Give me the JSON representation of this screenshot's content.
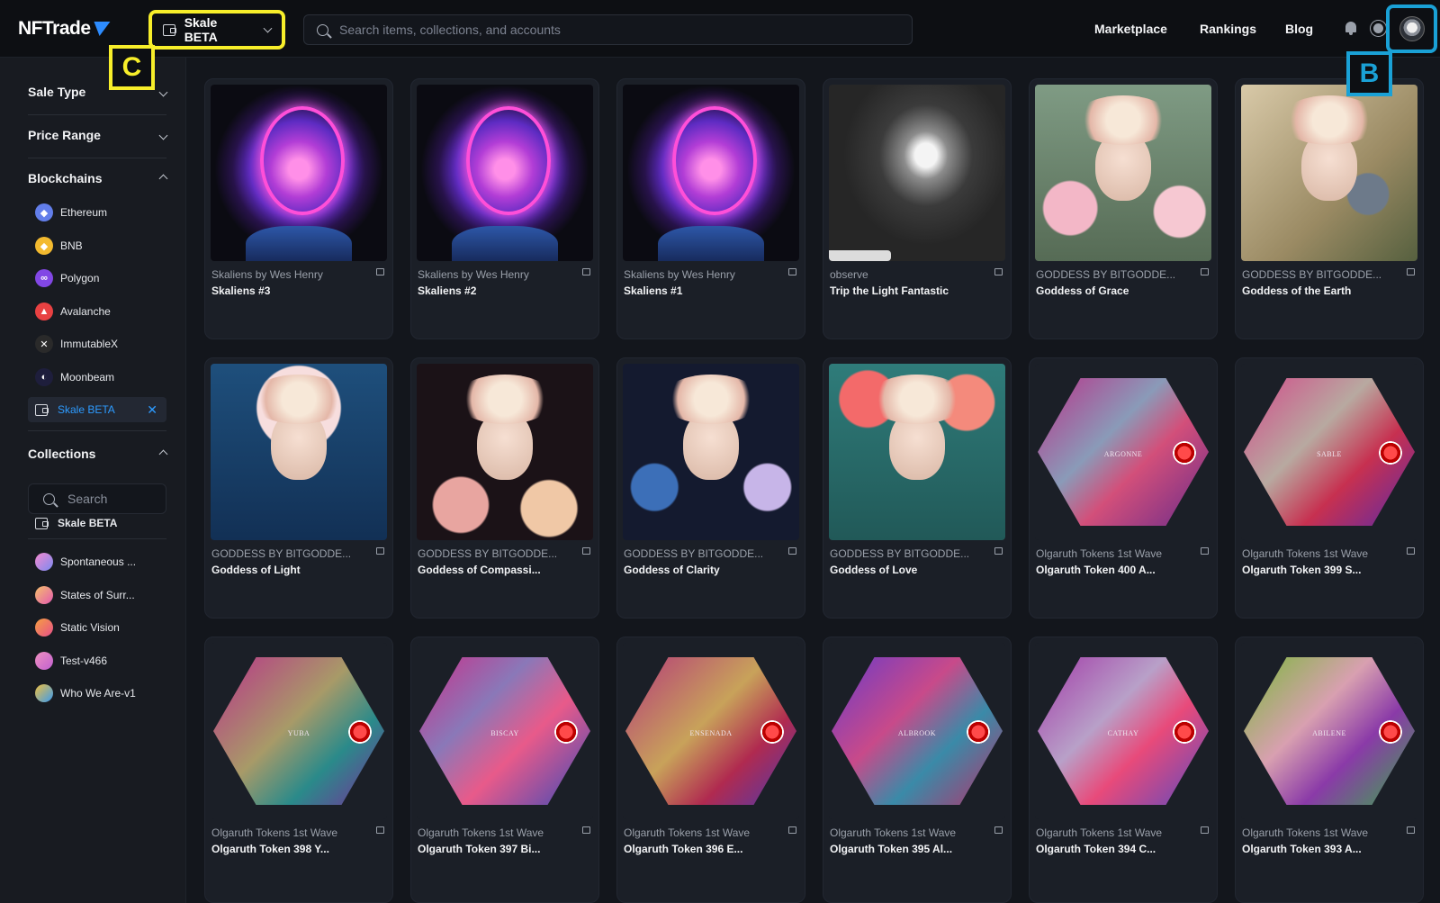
{
  "header": {
    "logo": "NFTrade",
    "chain_selector": "Skale BETA",
    "search_placeholder": "Search items, collections, and accounts",
    "nav": [
      "Marketplace",
      "Rankings",
      "Blog"
    ],
    "callout_c": "C",
    "callout_b": "B",
    "colors": {
      "callout_c": "#f7ee2a",
      "callout_b": "#1aa1d6"
    }
  },
  "sidebar": {
    "sale_type": "Sale Type",
    "price_range": "Price Range",
    "blockchains_title": "Blockchains",
    "blockchains": [
      {
        "label": "Ethereum",
        "icon": "ethereum-icon",
        "color": "#627eea"
      },
      {
        "label": "BNB",
        "icon": "bnb-icon",
        "color": "#f3ba2f"
      },
      {
        "label": "Polygon",
        "icon": "polygon-icon",
        "color": "#8247e5"
      },
      {
        "label": "Avalanche",
        "icon": "avalanche-icon",
        "color": "#e84142"
      },
      {
        "label": "ImmutableX",
        "icon": "immutablex-icon",
        "color": "#2a2a2a"
      },
      {
        "label": "Moonbeam",
        "icon": "moonbeam-icon",
        "color": "#1e1e3c"
      },
      {
        "label": "Skale BETA",
        "icon": "wallet-icon",
        "color": "#2d9bff",
        "active": true
      }
    ],
    "collections_title": "Collections",
    "collections_search_placeholder": "Search",
    "collections": [
      {
        "label": "Skale BETA"
      },
      {
        "label": "Spontaneous ..."
      },
      {
        "label": "States of Surr..."
      },
      {
        "label": "Static Vision"
      },
      {
        "label": "Test-v466"
      },
      {
        "label": "Who We Are-v1"
      }
    ]
  },
  "grid": [
    {
      "collection": "Skaliens by Wes Henry",
      "name": "Skaliens #3"
    },
    {
      "collection": "Skaliens by Wes Henry",
      "name": "Skaliens #2"
    },
    {
      "collection": "Skaliens by Wes Henry",
      "name": "Skaliens #1"
    },
    {
      "collection": "observe",
      "name": "Trip the Light Fantastic"
    },
    {
      "collection": "GODDESS BY BITGODDE...",
      "name": "Goddess of Grace"
    },
    {
      "collection": "GODDESS BY BITGODDE...",
      "name": "Goddess of the Earth"
    },
    {
      "collection": "GODDESS BY BITGODDE...",
      "name": "Goddess of Light"
    },
    {
      "collection": "GODDESS BY BITGODDE...",
      "name": "Goddess of Compassi..."
    },
    {
      "collection": "GODDESS BY BITGODDE...",
      "name": "Goddess of Clarity"
    },
    {
      "collection": "GODDESS BY BITGODDE...",
      "name": "Goddess of Love"
    },
    {
      "collection": "Olgaruth Tokens 1st Wave",
      "name": "Olgaruth Token 400 A...",
      "tag": "ARGONNE"
    },
    {
      "collection": "Olgaruth Tokens 1st Wave",
      "name": "Olgaruth Token 399 S...",
      "tag": "SABLE"
    },
    {
      "collection": "Olgaruth Tokens 1st Wave",
      "name": "Olgaruth Token 398 Y...",
      "tag": "YUBA"
    },
    {
      "collection": "Olgaruth Tokens 1st Wave",
      "name": "Olgaruth Token 397 Bi...",
      "tag": "BISCAY"
    },
    {
      "collection": "Olgaruth Tokens 1st Wave",
      "name": "Olgaruth Token 396 E...",
      "tag": "ENSENADA"
    },
    {
      "collection": "Olgaruth Tokens 1st Wave",
      "name": "Olgaruth Token 395 Al...",
      "tag": "ALBROOK"
    },
    {
      "collection": "Olgaruth Tokens 1st Wave",
      "name": "Olgaruth Token 394 C...",
      "tag": "CATHAY"
    },
    {
      "collection": "Olgaruth Tokens 1st Wave",
      "name": "Olgaruth Token 393 A...",
      "tag": "ABILENE"
    }
  ]
}
